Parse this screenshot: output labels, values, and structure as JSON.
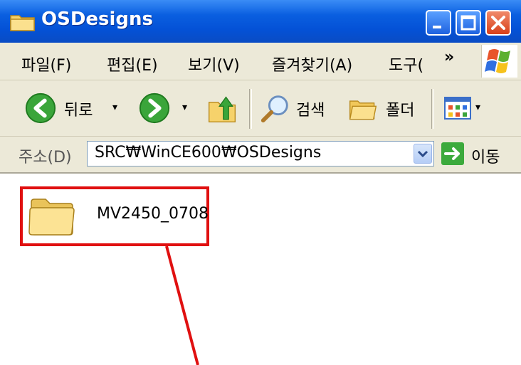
{
  "window": {
    "title": "OSDesigns"
  },
  "menu": {
    "items": [
      "파일(F)",
      "편집(E)",
      "보기(V)",
      "즐겨찾기(A)",
      "도구("
    ],
    "more": "»"
  },
  "toolbar": {
    "back_label": "뒤로",
    "search_label": "검색",
    "folders_label": "폴더",
    "dropdown_glyph": "▾"
  },
  "address": {
    "label": "주소(D)",
    "value": "SRC₩WinCE600₩OSDesigns",
    "go_label": "이동"
  },
  "content": {
    "items": [
      {
        "name": "MV2450_0708",
        "icon": "folder-icon"
      }
    ]
  },
  "colors": {
    "titlebar": "#0a5fe0",
    "highlight_border": "#e01010",
    "chrome": "#ece9d8"
  }
}
